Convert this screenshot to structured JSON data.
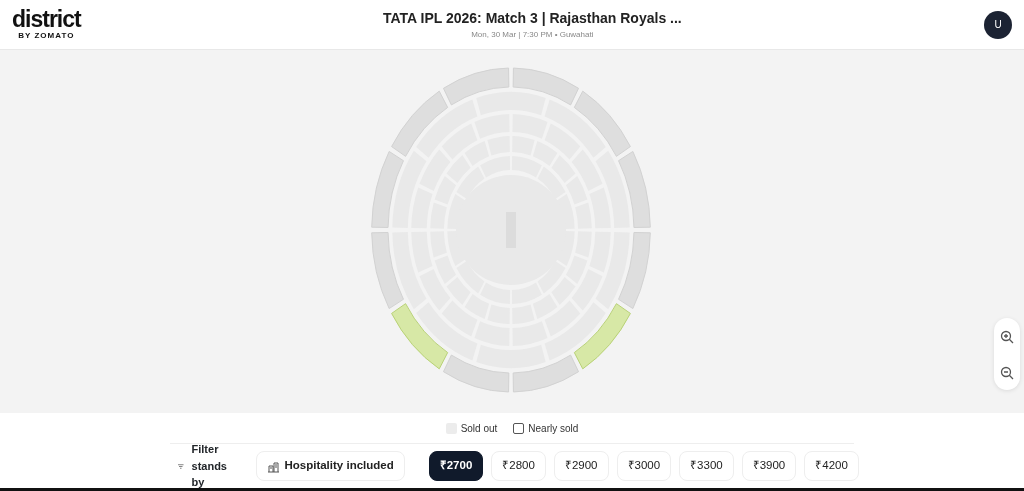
{
  "header": {
    "logo": "district",
    "logo_sub": "BY ZOMATO",
    "title": "TATA IPL 2026: Match 3 | Rajasthan Royals ...",
    "subtitle": "Mon, 30 Mar | 7:30 PM • Guwahati",
    "avatar": "U"
  },
  "stands": [
    {
      "available": false
    },
    {
      "available": true
    },
    {
      "available": false
    },
    {
      "available": false
    },
    {
      "available": true
    },
    {
      "available": false
    },
    {
      "available": false
    },
    {
      "available": false
    },
    {
      "available": false
    },
    {
      "available": false
    },
    {
      "available": false
    },
    {
      "available": false
    }
  ],
  "legend": [
    {
      "kind": "sold",
      "label": "Sold out"
    },
    {
      "kind": "nearly",
      "label": "Nearly sold"
    }
  ],
  "filter": {
    "label": "Filter stands by",
    "hospitality": "Hospitality included",
    "prices": [
      {
        "label": "₹2700",
        "selected": true
      },
      {
        "label": "₹2800",
        "selected": false
      },
      {
        "label": "₹2900",
        "selected": false
      },
      {
        "label": "₹3000",
        "selected": false
      },
      {
        "label": "₹3300",
        "selected": false
      },
      {
        "label": "₹3900",
        "selected": false
      },
      {
        "label": "₹4200",
        "selected": false
      }
    ]
  }
}
